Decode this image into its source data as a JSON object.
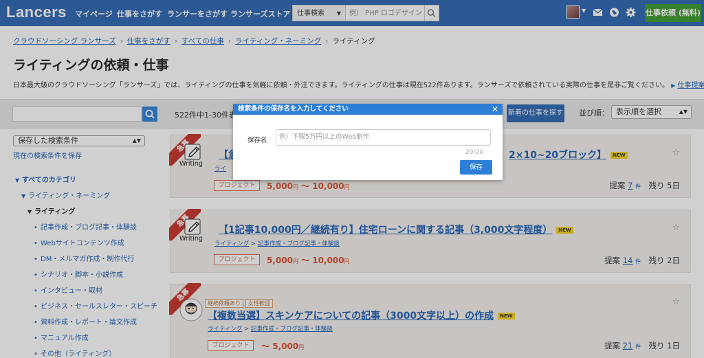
{
  "header": {
    "logo": "Lancers",
    "nav": [
      "マイページ",
      "仕事をさがす",
      "ランサーをさがす",
      "ランサーズストア"
    ],
    "search_type": "仕事検索",
    "search_placeholder": "例） PHP ロゴデザイン",
    "cta_label": "仕事依頼 (無料)"
  },
  "breadcrumb": {
    "items": [
      "クラウドソーシング ランサーズ",
      "仕事をさがす",
      "すべての仕事",
      "ライティング・ネーミング"
    ],
    "current": "ライティング"
  },
  "page": {
    "title": "ライティングの依頼・仕事",
    "description": "日本最大級のクラウドソーシング「ランサーズ」では、ライティングの仕事を気軽に依頼・外注できます。ライティングの仕事は現在522件あります。ランサーズで依頼されている実際の仕事を是非ご覧ください。",
    "description_link": "仕事提案の流れ"
  },
  "toolbar": {
    "result_count": "522件中1-30件表",
    "new_jobs_label": "新着の仕事を探す",
    "sort_label": "並び順：",
    "sort_value": "表示順を選択"
  },
  "sidebar": {
    "saved_select": "保存した検索条件",
    "save_link": "現在の検索条件を保存",
    "all_categories": "すべてのカテゴリ",
    "level1": "ライティング・ネーミング",
    "level2": "ライティング",
    "subcategories": [
      "記事作成・ブログ記事・体験談",
      "Webサイトコンテンツ作成",
      "DM・メルマガ作成・制作代行",
      "シナリオ・脚本・小説作成",
      "インタビュー・取材",
      "ビジネス・セールスレター・スピーチ",
      "資料作成・レポート・論文作成",
      "マニュアル作成",
      "その他（ライティング）"
    ]
  },
  "jobs": [
    {
      "urgent": "急募",
      "icon_label": "Writing",
      "title": "【急",
      "title_tail": "2×10~20ブロック】",
      "new": "NEW",
      "category": "ライ",
      "category_sub": "",
      "type": "プロジェクト",
      "price_min": "5,000",
      "price_max": "10,000",
      "unit": "円",
      "proposals_label": "提案",
      "proposals": "7",
      "count_unit": "件",
      "remaining_label": "残り",
      "remaining": "5日"
    },
    {
      "urgent": "急募",
      "icon_label": "Writing",
      "title": "【1記事10,000円／継続有り】住宅ローンに関する記事（3,000文字程度）",
      "title_tail": "",
      "new": "NEW",
      "category": "ライティング",
      "category_sub": "記事作成・ブログ記事・体験談",
      "type": "プロジェクト",
      "price_min": "5,000",
      "price_max": "10,000",
      "unit": "円",
      "proposals_label": "提案",
      "proposals": "14",
      "count_unit": "件",
      "remaining_label": "残り",
      "remaining": "2日"
    },
    {
      "urgent": "急募",
      "icon_label": "",
      "tags": [
        "継続依頼あり",
        "女性歓迎"
      ],
      "title": "【複数当選】スキンケアについての記事（3000文字以上）の作成",
      "title_tail": "",
      "new": "NEW",
      "category": "ライティング",
      "category_sub": "記事作成・ブログ記事・体験談",
      "type": "プロジェクト",
      "price_min": "",
      "price_max": "5,000",
      "unit": "円",
      "proposals_label": "提案",
      "proposals": "21",
      "count_unit": "件",
      "remaining_label": "残り",
      "remaining": "1日"
    }
  ],
  "modal": {
    "title": "検索条件の保存名を入力してください",
    "close": "✕",
    "label": "保存名",
    "placeholder": "例）下限5万円以上のWeb制作",
    "counter": "20/20",
    "save_label": "保存"
  }
}
